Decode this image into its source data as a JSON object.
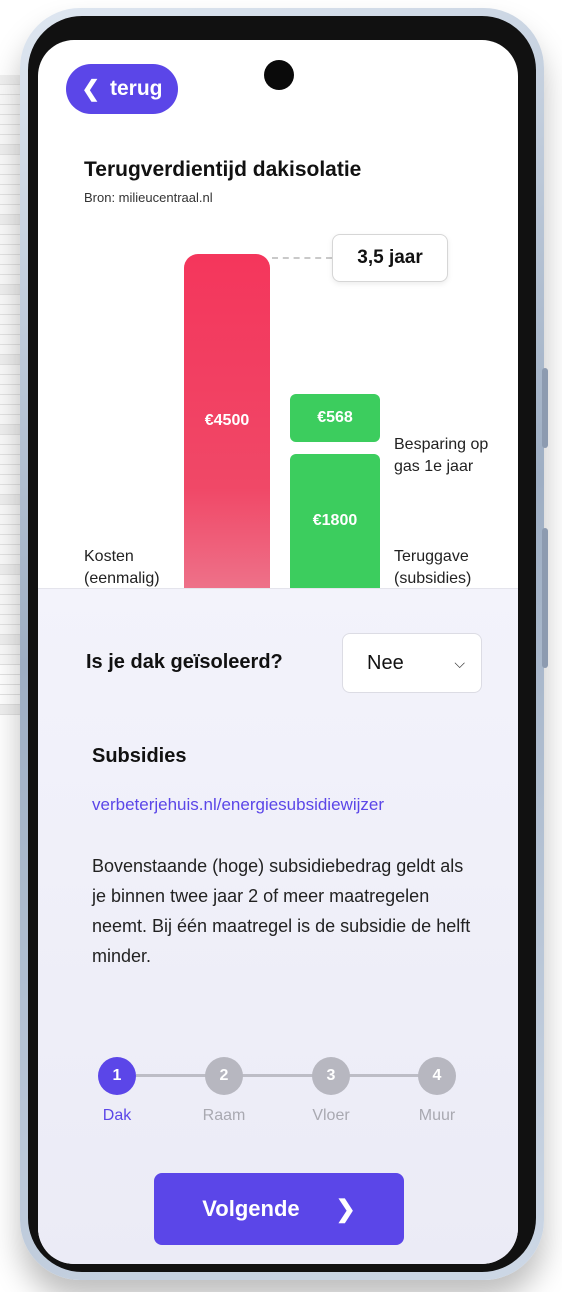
{
  "header": {
    "back_label": "terug"
  },
  "chart_section": {
    "title": "Terugverdientijd dakisolatie",
    "source": "Bron: milieucentraal.nl",
    "callout": "3,5 jaar"
  },
  "chart_data": {
    "type": "bar",
    "bars": [
      {
        "label": "Kosten (eenmalig)",
        "value_label": "€4500",
        "value": 4500
      },
      {
        "label": "Teruggave (subsidies)",
        "value_label": "€1800",
        "value": 1800
      },
      {
        "label": "Besparing op gas 1e jaar",
        "value_label": "€568",
        "value": 568
      }
    ],
    "labels": {
      "cost_line1": "Kosten",
      "cost_line2": "(eenmalig)",
      "subsidy_line1": "Teruggave",
      "subsidy_line2": "(subsidies)",
      "saving_line1": "Besparing op",
      "saving_line2": "gas 1e jaar"
    },
    "colors": {
      "cost": "#f4365c",
      "green": "#3ccd5e"
    }
  },
  "question": {
    "label": "Is je dak geïsoleerd?",
    "selected": "Nee"
  },
  "subsidies": {
    "title": "Subsidies",
    "link": "verbeterjehuis.nl/energiesubsidiewijzer",
    "text": "Bovenstaande (hoge) subsidiebedrag geldt als je binnen twee jaar 2 of meer maatregelen neemt. Bij één maatregel is de subsidie de helft minder."
  },
  "steps": [
    {
      "number": "1",
      "label": "Dak",
      "active": true
    },
    {
      "number": "2",
      "label": "Raam",
      "active": false
    },
    {
      "number": "3",
      "label": "Vloer",
      "active": false
    },
    {
      "number": "4",
      "label": "Muur",
      "active": false
    }
  ],
  "footer": {
    "next_label": "Volgende"
  },
  "colors": {
    "accent": "#5b46e8"
  }
}
